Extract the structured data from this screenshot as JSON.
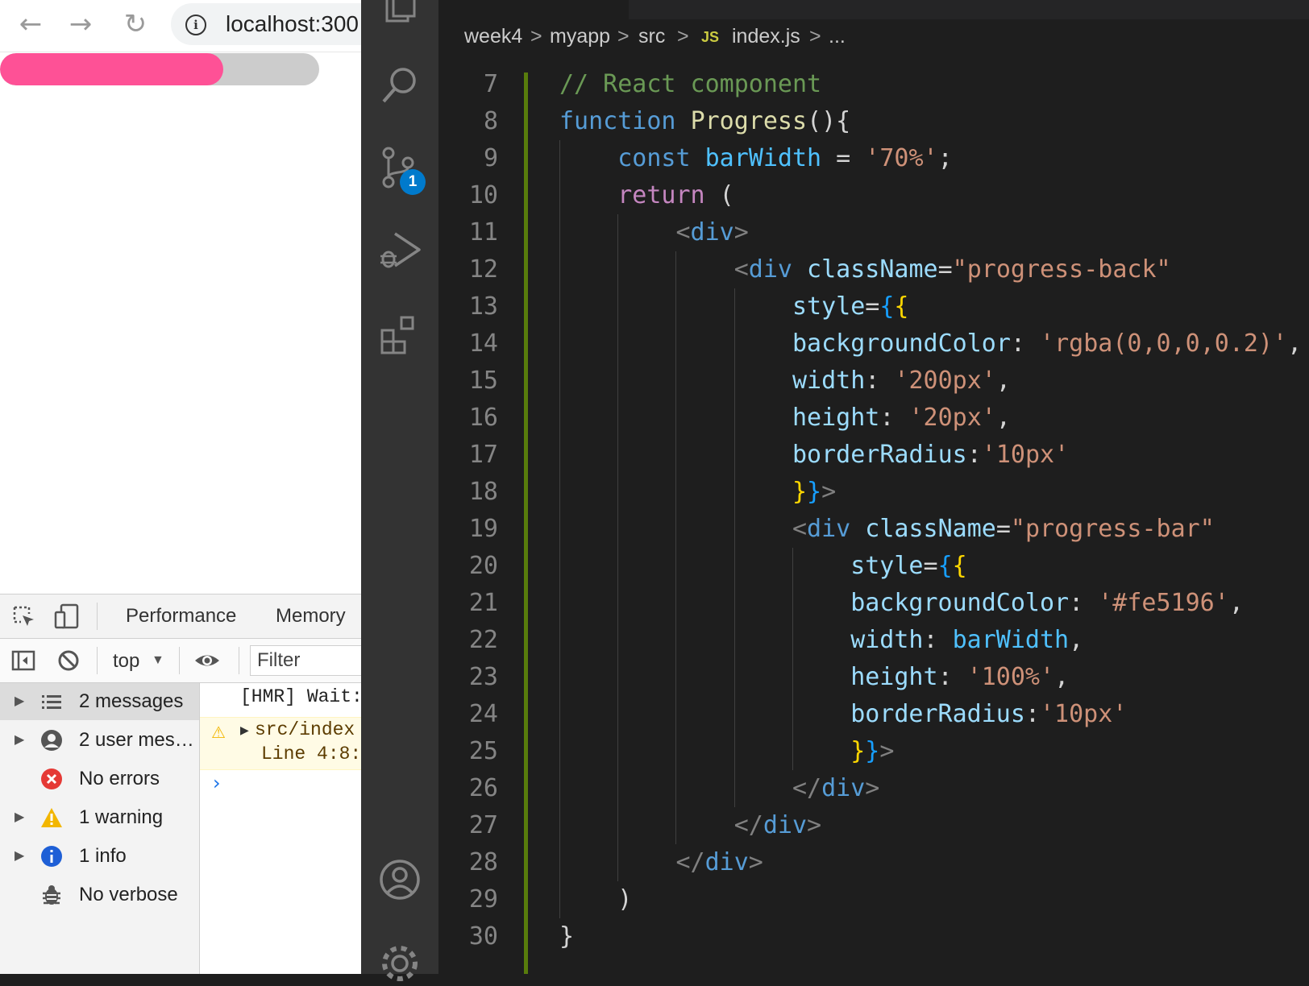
{
  "browser": {
    "url": "localhost:300",
    "nav": {
      "back": "←",
      "forward": "→",
      "reload": "↻"
    },
    "progress": {
      "value_percent": 70,
      "fill_color": "#fe5196",
      "track_color": "rgba(0,0,0,0.2)"
    }
  },
  "devtools": {
    "tabs": [
      "Performance",
      "Memory"
    ],
    "context": "top",
    "filter_placeholder": "Filter",
    "sidebar": [
      {
        "label": "2 messages",
        "icon": "list-icon",
        "expandable": true,
        "selected": true
      },
      {
        "label": "2 user mes…",
        "icon": "user-icon",
        "expandable": true,
        "selected": false
      },
      {
        "label": "No errors",
        "icon": "error-icon",
        "expandable": false,
        "selected": false
      },
      {
        "label": "1 warning",
        "icon": "warning-icon",
        "expandable": true,
        "selected": false
      },
      {
        "label": "1 info",
        "icon": "info-icon",
        "expandable": true,
        "selected": false
      },
      {
        "label": "No verbose",
        "icon": "bug-icon",
        "expandable": false,
        "selected": false
      }
    ],
    "log": {
      "hmr": "[HMR] Wait:",
      "warning_line1": "src/index",
      "warning_line2": "Line 4:8:",
      "prompt": "›"
    }
  },
  "vscode": {
    "scm_badge": "1",
    "breadcrumb": {
      "items": [
        "week4",
        "myapp",
        "src",
        "index.js",
        "..."
      ],
      "js_badge": "JS",
      "sep": ">"
    },
    "code_lines": [
      {
        "n": "7",
        "indent": 0,
        "tokens": [
          [
            "// React component",
            "t-comment"
          ]
        ]
      },
      {
        "n": "8",
        "indent": 0,
        "tokens": [
          [
            "function",
            "t-keyword"
          ],
          [
            " ",
            "t-plain"
          ],
          [
            "Progress",
            "t-func"
          ],
          [
            "(){",
            "t-plain"
          ]
        ]
      },
      {
        "n": "9",
        "indent": 1,
        "tokens": [
          [
            "const",
            "t-keyword"
          ],
          [
            " ",
            "t-plain"
          ],
          [
            "barWidth",
            "t-var"
          ],
          [
            " = ",
            "t-plain"
          ],
          [
            "'70%'",
            "t-str"
          ],
          [
            ";",
            "t-plain"
          ]
        ]
      },
      {
        "n": "10",
        "indent": 1,
        "tokens": [
          [
            "return",
            "t-control"
          ],
          [
            " (",
            "t-plain"
          ]
        ]
      },
      {
        "n": "11",
        "indent": 2,
        "tokens": [
          [
            "<",
            "t-angle"
          ],
          [
            "div",
            "t-tag"
          ],
          [
            ">",
            "t-angle"
          ]
        ]
      },
      {
        "n": "12",
        "indent": 3,
        "tokens": [
          [
            "<",
            "t-angle"
          ],
          [
            "div",
            "t-tag"
          ],
          [
            " ",
            "t-plain"
          ],
          [
            "className",
            "t-attr"
          ],
          [
            "=",
            "t-plain"
          ],
          [
            "\"progress-back\"",
            "t-str"
          ]
        ]
      },
      {
        "n": "13",
        "indent": 4,
        "tokens": [
          [
            "style",
            "t-attr"
          ],
          [
            "=",
            "t-plain"
          ],
          [
            "{",
            "t-brace3"
          ],
          [
            "{",
            "t-brace1"
          ]
        ]
      },
      {
        "n": "14",
        "indent": 4,
        "tokens": [
          [
            "backgroundColor",
            "t-prop"
          ],
          [
            ": ",
            "t-plain"
          ],
          [
            "'rgba(0,0,0,0.2)'",
            "t-str"
          ],
          [
            ",",
            "t-plain"
          ]
        ]
      },
      {
        "n": "15",
        "indent": 4,
        "tokens": [
          [
            "width",
            "t-prop"
          ],
          [
            ": ",
            "t-plain"
          ],
          [
            "'200px'",
            "t-str"
          ],
          [
            ",",
            "t-plain"
          ]
        ]
      },
      {
        "n": "16",
        "indent": 4,
        "tokens": [
          [
            "height",
            "t-prop"
          ],
          [
            ": ",
            "t-plain"
          ],
          [
            "'20px'",
            "t-str"
          ],
          [
            ",",
            "t-plain"
          ]
        ]
      },
      {
        "n": "17",
        "indent": 4,
        "tokens": [
          [
            "borderRadius",
            "t-prop"
          ],
          [
            ":",
            "t-plain"
          ],
          [
            "'10px'",
            "t-str"
          ]
        ]
      },
      {
        "n": "18",
        "indent": 4,
        "tokens": [
          [
            "}",
            "t-brace1"
          ],
          [
            "}",
            "t-brace3"
          ],
          [
            ">",
            "t-angle"
          ]
        ]
      },
      {
        "n": "19",
        "indent": 4,
        "tokens": [
          [
            "<",
            "t-angle"
          ],
          [
            "div",
            "t-tag"
          ],
          [
            " ",
            "t-plain"
          ],
          [
            "className",
            "t-attr"
          ],
          [
            "=",
            "t-plain"
          ],
          [
            "\"progress-bar\"",
            "t-str"
          ]
        ]
      },
      {
        "n": "20",
        "indent": 5,
        "tokens": [
          [
            "style",
            "t-attr"
          ],
          [
            "=",
            "t-plain"
          ],
          [
            "{",
            "t-brace3"
          ],
          [
            "{",
            "t-brace1"
          ]
        ]
      },
      {
        "n": "21",
        "indent": 5,
        "tokens": [
          [
            "backgroundColor",
            "t-prop"
          ],
          [
            ": ",
            "t-plain"
          ],
          [
            "'#fe5196'",
            "t-str"
          ],
          [
            ",",
            "t-plain"
          ]
        ]
      },
      {
        "n": "22",
        "indent": 5,
        "tokens": [
          [
            "width",
            "t-prop"
          ],
          [
            ": ",
            "t-plain"
          ],
          [
            "barWidth",
            "t-var"
          ],
          [
            ",",
            "t-plain"
          ]
        ]
      },
      {
        "n": "23",
        "indent": 5,
        "tokens": [
          [
            "height",
            "t-prop"
          ],
          [
            ": ",
            "t-plain"
          ],
          [
            "'100%'",
            "t-str"
          ],
          [
            ",",
            "t-plain"
          ]
        ]
      },
      {
        "n": "24",
        "indent": 5,
        "tokens": [
          [
            "borderRadius",
            "t-prop"
          ],
          [
            ":",
            "t-plain"
          ],
          [
            "'10px'",
            "t-str"
          ]
        ]
      },
      {
        "n": "25",
        "indent": 5,
        "tokens": [
          [
            "}",
            "t-brace1"
          ],
          [
            "}",
            "t-brace3"
          ],
          [
            ">",
            "t-angle"
          ]
        ]
      },
      {
        "n": "26",
        "indent": 4,
        "tokens": [
          [
            "</",
            "t-angle"
          ],
          [
            "div",
            "t-tag"
          ],
          [
            ">",
            "t-angle"
          ]
        ]
      },
      {
        "n": "27",
        "indent": 3,
        "tokens": [
          [
            "</",
            "t-angle"
          ],
          [
            "div",
            "t-tag"
          ],
          [
            ">",
            "t-angle"
          ]
        ]
      },
      {
        "n": "28",
        "indent": 2,
        "tokens": [
          [
            "</",
            "t-angle"
          ],
          [
            "div",
            "t-tag"
          ],
          [
            ">",
            "t-angle"
          ]
        ]
      },
      {
        "n": "29",
        "indent": 1,
        "tokens": [
          [
            ")",
            "t-plain"
          ]
        ]
      },
      {
        "n": "30",
        "indent": 0,
        "tokens": [
          [
            "}",
            "t-plain"
          ]
        ]
      }
    ]
  }
}
